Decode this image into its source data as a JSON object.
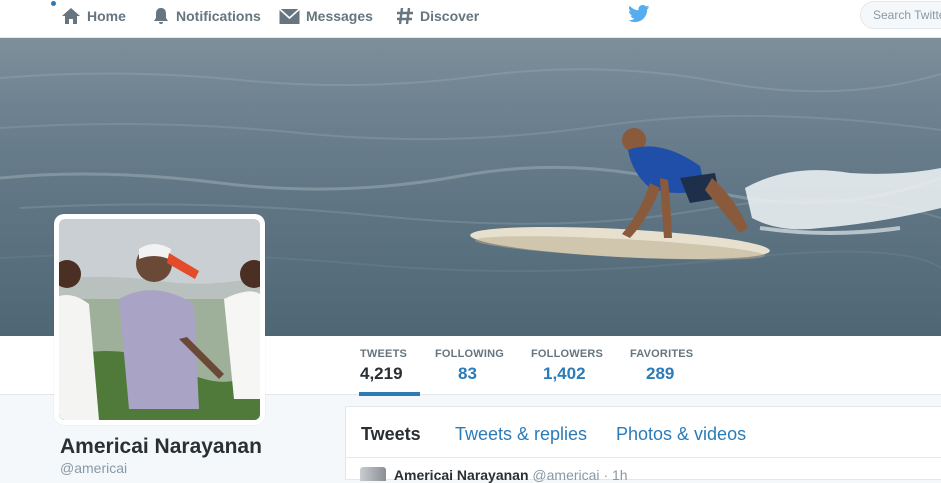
{
  "nav": {
    "home_label": "Home",
    "notifications_label": "Notifications",
    "messages_label": "Messages",
    "discover_label": "Discover",
    "search_placeholder": "Search Twitter"
  },
  "profile": {
    "name": "Americai Narayanan",
    "handle": "@americai"
  },
  "stats": [
    {
      "label": "TWEETS",
      "value": "4,219"
    },
    {
      "label": "FOLLOWING",
      "value": "83"
    },
    {
      "label": "FOLLOWERS",
      "value": "1,402"
    },
    {
      "label": "FAVORITES",
      "value": "289"
    }
  ],
  "timeline": {
    "tabs": [
      "Tweets",
      "Tweets & replies",
      "Photos & videos"
    ],
    "first_tweet": {
      "name": "Americai Narayanan",
      "handle": "@americai",
      "separator": "·",
      "time": "1h"
    }
  },
  "colors": {
    "brand_blue": "#2b7bb9",
    "twitter_bird": "#55acee",
    "muted_text": "#66757f"
  }
}
